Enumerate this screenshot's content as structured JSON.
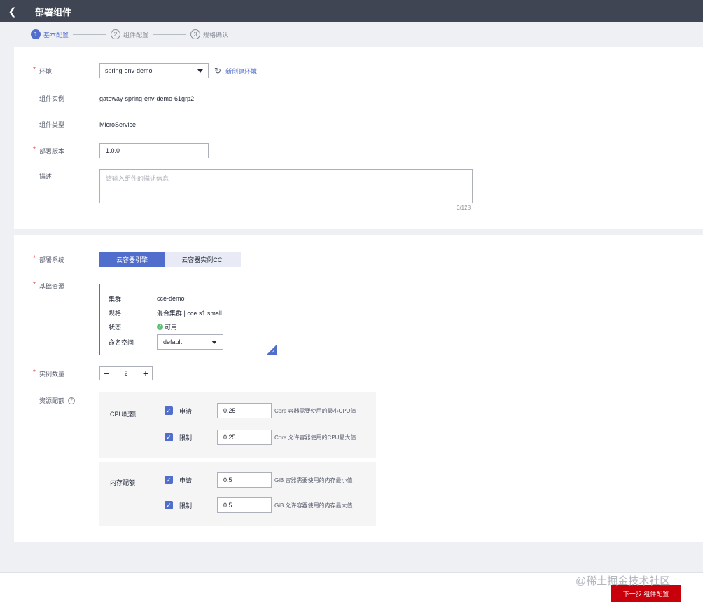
{
  "header": {
    "title": "部署组件",
    "back_icon": "chevron-left-icon"
  },
  "steps": [
    {
      "num": "1",
      "label": "基本配置"
    },
    {
      "num": "2",
      "label": "组件配置"
    },
    {
      "num": "3",
      "label": "规格确认"
    }
  ],
  "basic": {
    "env_label": "环境",
    "env_value": "spring-env-demo",
    "new_env_link": "新创建环境",
    "instance_label": "组件实例",
    "instance_value": "gateway-spring-env-demo-61grp2",
    "type_label": "组件类型",
    "type_value": "MicroService",
    "version_label": "部署版本",
    "version_value": "1.0.0",
    "desc_label": "描述",
    "desc_placeholder": "请输入组件的描述信息",
    "desc_counter": "0/128"
  },
  "deploy": {
    "system_label": "部署系统",
    "system_options": [
      "云容器引擎",
      "云容器实例CCI"
    ],
    "resource_label": "基础资源",
    "resource": {
      "cluster_key": "集群",
      "cluster_val": "cce-demo",
      "spec_key": "规格",
      "spec_val": "混合集群 | cce.s1.small",
      "status_key": "状态",
      "status_val": "可用",
      "ns_key": "命名空间",
      "ns_val": "default"
    },
    "count_label": "实例数量",
    "count_value": "2",
    "quota_label": "资源配额",
    "cpu": {
      "title": "CPU配额",
      "request_label": "申请",
      "request_value": "0.25",
      "request_hint": "Core 容器需要使用的最小CPU值",
      "limit_label": "限制",
      "limit_value": "0.25",
      "limit_hint": "Core 允许容器使用的CPU最大值"
    },
    "mem": {
      "title": "内存配额",
      "request_label": "申请",
      "request_value": "0.5",
      "request_hint": "GiB 容器需要使用的内存最小值",
      "limit_label": "限制",
      "limit_value": "0.5",
      "limit_hint": "GiB 允许容器使用的内存最大值"
    }
  },
  "footer": {
    "next_button": "下一步 组件配置",
    "watermark": "@稀土掘金技术社区"
  },
  "colors": {
    "accent": "#526ecc",
    "primary_button": "#c7000b",
    "topbar": "#3f4552"
  }
}
